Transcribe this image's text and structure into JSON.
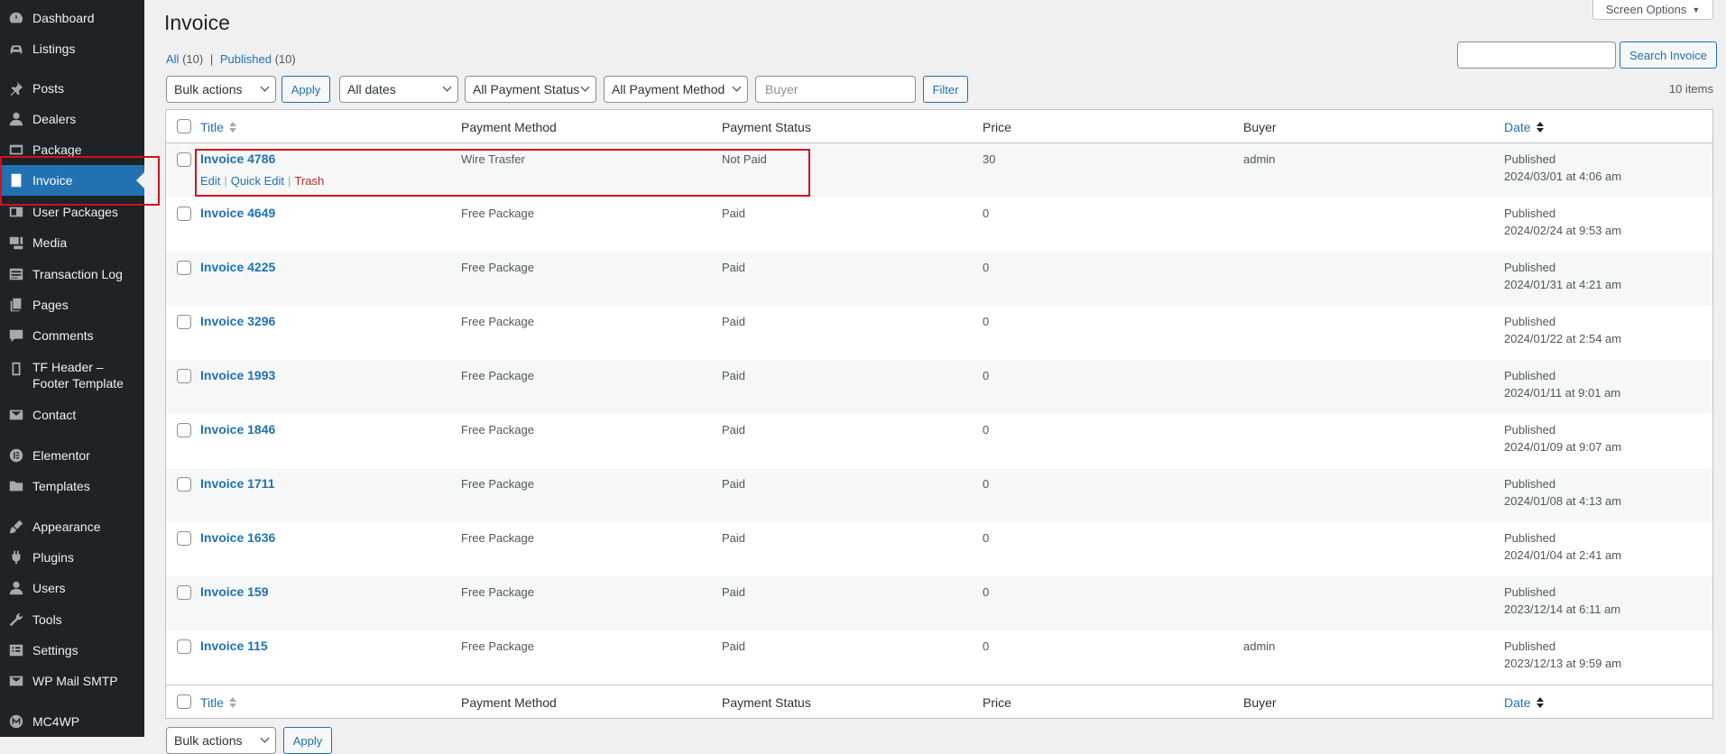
{
  "sidebar": {
    "items": [
      {
        "label": "Dashboard",
        "icon": "dashboard-icon"
      },
      {
        "label": "Listings",
        "icon": "car-icon"
      },
      {
        "label": "Posts",
        "icon": "pin-icon"
      },
      {
        "label": "Dealers",
        "icon": "user-icon"
      },
      {
        "label": "Package",
        "icon": "package-icon"
      },
      {
        "label": "Invoice",
        "icon": "document-icon"
      },
      {
        "label": "User Packages",
        "icon": "id-card-icon"
      },
      {
        "label": "Media",
        "icon": "media-icon"
      },
      {
        "label": "Transaction Log",
        "icon": "list-icon"
      },
      {
        "label": "Pages",
        "icon": "pages-icon"
      },
      {
        "label": "Comments",
        "icon": "comment-icon"
      },
      {
        "label": "TF Header –\nFooter Template",
        "icon": "template-icon"
      },
      {
        "label": "Contact",
        "icon": "mail-icon"
      },
      {
        "label": "Elementor",
        "icon": "elementor-icon"
      },
      {
        "label": "Templates",
        "icon": "folder-icon"
      },
      {
        "label": "Appearance",
        "icon": "brush-icon"
      },
      {
        "label": "Plugins",
        "icon": "plugin-icon"
      },
      {
        "label": "Users",
        "icon": "users-icon"
      },
      {
        "label": "Tools",
        "icon": "wrench-icon"
      },
      {
        "label": "Settings",
        "icon": "settings-icon"
      },
      {
        "label": "WP Mail SMTP",
        "icon": "mail-icon"
      },
      {
        "label": "MC4WP",
        "icon": "mc4wp-icon"
      }
    ]
  },
  "header": {
    "title": "Invoice",
    "screen_options": "Screen Options"
  },
  "views": {
    "all_label": "All",
    "all_count": "(10)",
    "separator": "|",
    "published_label": "Published",
    "published_count": "(10)"
  },
  "search": {
    "value": "",
    "button": "Search Invoice"
  },
  "filters": {
    "bulk_actions": "Bulk actions",
    "apply": "Apply",
    "dates": "All dates",
    "payment_status": "All Payment Status",
    "payment_method": "All Payment Method",
    "buyer_placeholder": "Buyer",
    "filter": "Filter",
    "items_count": "10 items"
  },
  "table": {
    "columns": {
      "title": "Title",
      "payment_method": "Payment Method",
      "payment_status": "Payment Status",
      "price": "Price",
      "buyer": "Buyer",
      "date": "Date"
    },
    "row_actions": {
      "edit": "Edit",
      "quick_edit": "Quick Edit",
      "trash": "Trash",
      "sep": "|"
    },
    "rows": [
      {
        "title": "Invoice 4786",
        "method": "Wire Trasfer",
        "status": "Not Paid",
        "price": "30",
        "buyer": "admin",
        "state": "Published",
        "date": "2024/03/01 at 4:06 am"
      },
      {
        "title": "Invoice 4649",
        "method": "Free Package",
        "status": "Paid",
        "price": "0",
        "buyer": "",
        "state": "Published",
        "date": "2024/02/24 at 9:53 am"
      },
      {
        "title": "Invoice 4225",
        "method": "Free Package",
        "status": "Paid",
        "price": "0",
        "buyer": "",
        "state": "Published",
        "date": "2024/01/31 at 4:21 am"
      },
      {
        "title": "Invoice 3296",
        "method": "Free Package",
        "status": "Paid",
        "price": "0",
        "buyer": "",
        "state": "Published",
        "date": "2024/01/22 at 2:54 am"
      },
      {
        "title": "Invoice 1993",
        "method": "Free Package",
        "status": "Paid",
        "price": "0",
        "buyer": "",
        "state": "Published",
        "date": "2024/01/11 at 9:01 am"
      },
      {
        "title": "Invoice 1846",
        "method": "Free Package",
        "status": "Paid",
        "price": "0",
        "buyer": "",
        "state": "Published",
        "date": "2024/01/09 at 9:07 am"
      },
      {
        "title": "Invoice 1711",
        "method": "Free Package",
        "status": "Paid",
        "price": "0",
        "buyer": "",
        "state": "Published",
        "date": "2024/01/08 at 4:13 am"
      },
      {
        "title": "Invoice 1636",
        "method": "Free Package",
        "status": "Paid",
        "price": "0",
        "buyer": "",
        "state": "Published",
        "date": "2024/01/04 at 2:41 am"
      },
      {
        "title": "Invoice 159",
        "method": "Free Package",
        "status": "Paid",
        "price": "0",
        "buyer": "",
        "state": "Published",
        "date": "2023/12/14 at 6:11 am"
      },
      {
        "title": "Invoice 115",
        "method": "Free Package",
        "status": "Paid",
        "price": "0",
        "buyer": "admin",
        "state": "Published",
        "date": "2023/12/13 at 9:59 am"
      }
    ]
  },
  "colors": {
    "sidebar_bg": "#1d2327",
    "accent": "#2271b1",
    "highlight": "#d4101b",
    "trash": "#b32d2e"
  }
}
